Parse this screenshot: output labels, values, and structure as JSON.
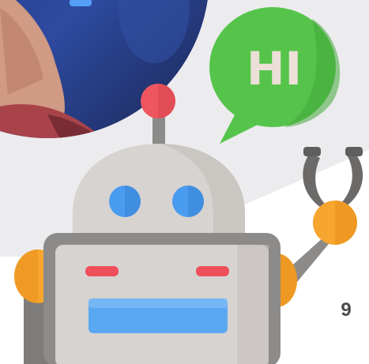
{
  "speech_bubble": {
    "text": "HI"
  },
  "page_number": "9",
  "colors": {
    "background_panel": "#ececee",
    "bubble_green": "#56c44a",
    "bubble_green_dark": "#42a83a",
    "bubble_text": "#ecdfd8",
    "robot_body": "#d6d3d0",
    "robot_body_light": "#e3e0dd",
    "robot_frame_dark": "#8c8b89",
    "robot_eye_blue": "#4a9cf0",
    "robot_mouth_blue": "#5aa8f2",
    "robot_cheek_red": "#ef4f5a",
    "antenna_red": "#ef5660",
    "joint_orange": "#f6a52e",
    "arm_gray": "#6b6a68"
  },
  "icons": {
    "robot": "robot-icon",
    "speech_bubble": "speech-bubble-icon",
    "claw": "claw-icon",
    "photo": "person-photo"
  }
}
